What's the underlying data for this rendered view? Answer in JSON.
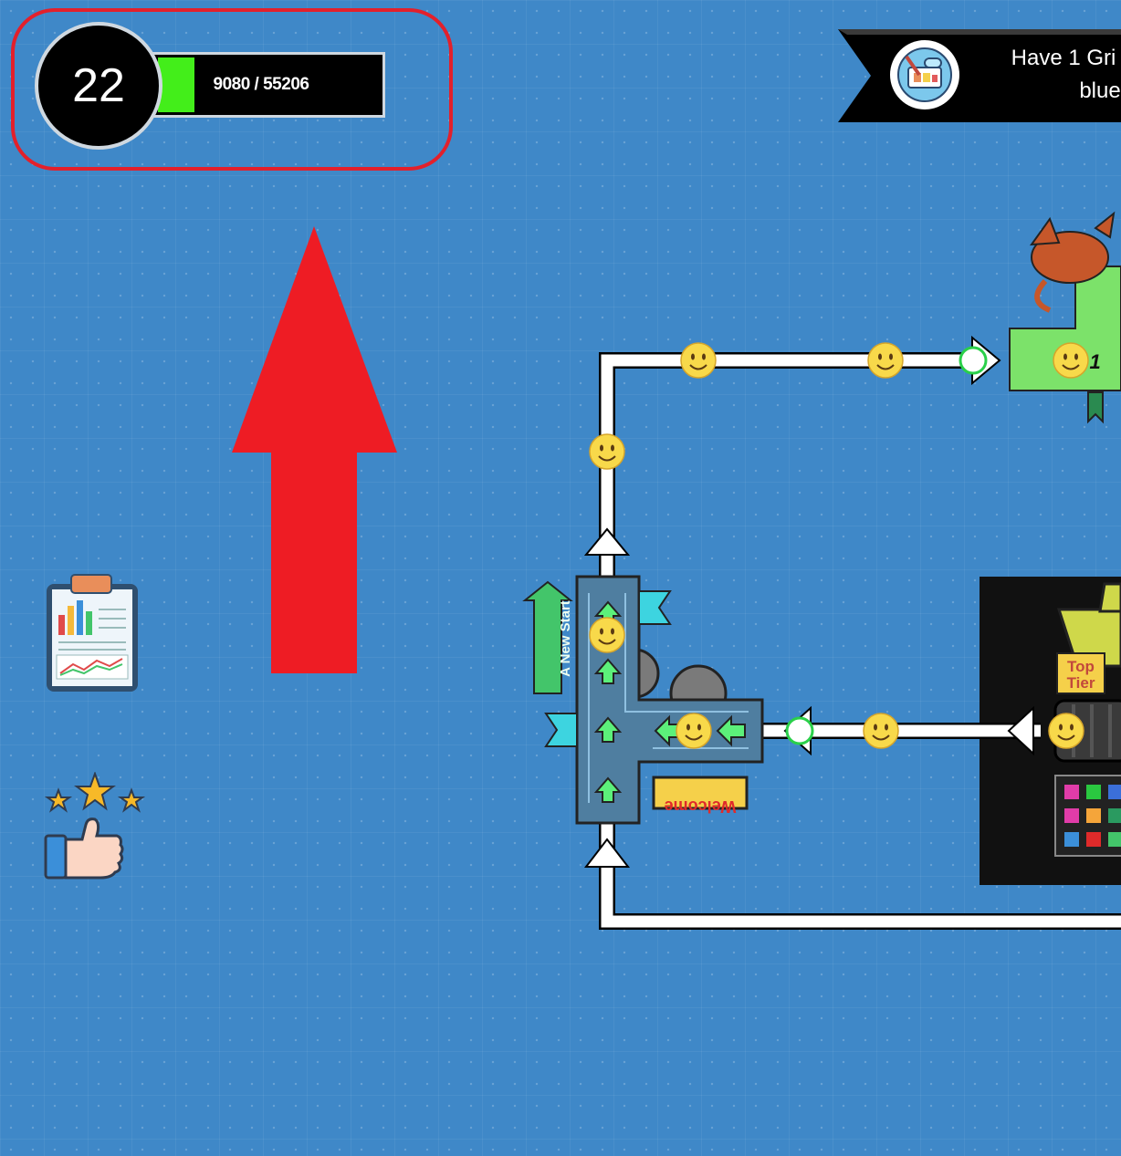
{
  "player": {
    "level": "22",
    "xp_text": "9080 / 55206",
    "xp_current": 9080,
    "xp_max": 55206
  },
  "quest": {
    "line1": "Have 1 Gri",
    "line2": "blue"
  },
  "map": {
    "hub_sign": "A New Start",
    "welcome_sign": "Welcome",
    "area1_label": "L  1",
    "shop_tag_line1": "Top",
    "shop_tag_line2": "Tier"
  },
  "icons": {
    "quest": "gamepad-design-icon",
    "stats": "clipboard-chart-icon",
    "rating": "thumbs-up-stars-icon",
    "traveler": "smiley-face-icon",
    "dragon": "dragon-icon"
  },
  "colors": {
    "background": "#3f88c8",
    "xp_fill": "#43ee1a",
    "highlight": "#e3202b",
    "arrow": "#ee1c24"
  }
}
